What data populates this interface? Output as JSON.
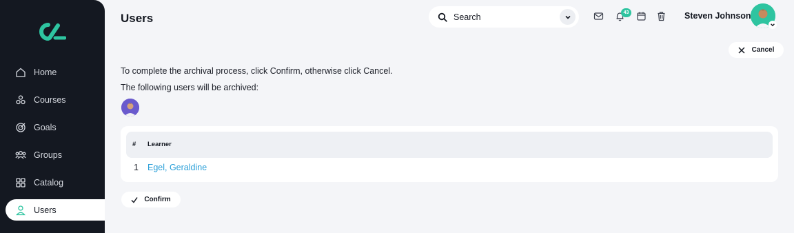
{
  "sidebar": {
    "logo_icon": "brand-logo",
    "accent": "#2ec4a0",
    "items": [
      {
        "label": "Home",
        "icon": "home-icon"
      },
      {
        "label": "Courses",
        "icon": "courses-icon"
      },
      {
        "label": "Goals",
        "icon": "goals-icon"
      },
      {
        "label": "Groups",
        "icon": "groups-icon"
      },
      {
        "label": "Catalog",
        "icon": "catalog-icon"
      },
      {
        "label": "Users",
        "icon": "user-icon",
        "active": true
      }
    ]
  },
  "header": {
    "title": "Users",
    "search": {
      "placeholder": "Search"
    },
    "notifications_count": "43",
    "user_name": "Steven Johnson"
  },
  "actions": {
    "cancel_label": "Cancel",
    "confirm_label": "Confirm"
  },
  "content": {
    "instruction": "To complete the archival process, click Confirm, otherwise click Cancel.",
    "subheading": "The following users will be archived:"
  },
  "table": {
    "columns": [
      "#",
      "Learner"
    ],
    "rows": [
      {
        "num": "1",
        "learner": "Egel, Geraldine"
      }
    ]
  },
  "colors": {
    "link": "#2a9fd8",
    "sidebar_bg": "#141821",
    "page_bg": "#f4f5f8"
  }
}
